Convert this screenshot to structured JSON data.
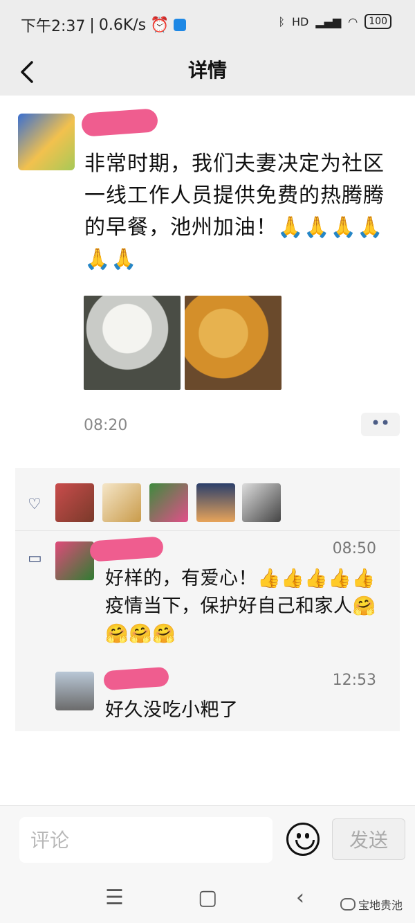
{
  "status_bar": {
    "time": "下午2:37",
    "net_speed": "0.6K/s",
    "signal_label": "HD",
    "battery": "100",
    "icons": [
      "alarm-icon",
      "app-badge-icon",
      "bluetooth-icon",
      "signal-icon",
      "wifi-icon",
      "battery-icon"
    ]
  },
  "nav": {
    "title": "详情",
    "back_icon": "chevron-left-icon"
  },
  "post": {
    "text": "非常时期，我们夫妻决定为社区一线工作人员提供免费的热腾腾的早餐，池州加油！🙏🙏🙏🙏🙏🙏",
    "photos": [
      "steamed-buns-photo",
      "fried-cakes-photo"
    ],
    "time": "08:20",
    "more_label": "••"
  },
  "likes": {
    "icon": "heart-icon",
    "liker_count": 5
  },
  "comments": [
    {
      "time": "08:50",
      "text": "好样的，有爱心！👍👍👍👍👍疫情当下，保护好自己和家人🤗🤗🤗🤗"
    },
    {
      "time": "12:53",
      "text": "好久没吃小粑了"
    }
  ],
  "comment_icon": "speech-bubble-icon",
  "input_bar": {
    "placeholder": "评论",
    "send_label": "发送",
    "emoji_icon": "smiley-icon"
  },
  "system_nav": {
    "menu": "☰",
    "home": "▢",
    "back": "‹"
  },
  "watermark": "宝地贵池",
  "colors": {
    "link_blue": "#4c5d86",
    "redaction_pink": "#ef5d8f",
    "bar_gray": "#ededed"
  }
}
